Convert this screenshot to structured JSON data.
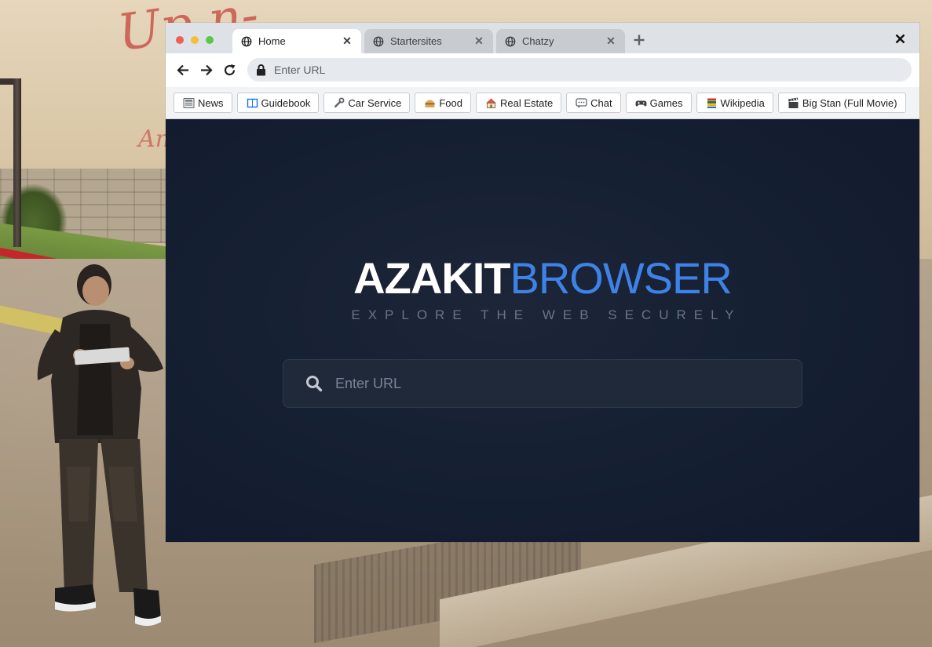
{
  "window": {
    "tabs": [
      {
        "label": "Home",
        "active": true
      },
      {
        "label": "Startersites",
        "active": false
      },
      {
        "label": "Chatzy",
        "active": false
      }
    ]
  },
  "toolbar": {
    "url_placeholder": "Enter URL"
  },
  "bookmarks": [
    {
      "label": "News",
      "icon": "newspaper-icon"
    },
    {
      "label": "Guidebook",
      "icon": "book-icon"
    },
    {
      "label": "Car Service",
      "icon": "wrench-icon"
    },
    {
      "label": "Food",
      "icon": "burger-icon"
    },
    {
      "label": "Real Estate",
      "icon": "house-icon"
    },
    {
      "label": "Chat",
      "icon": "speech-bubble-icon"
    },
    {
      "label": "Games",
      "icon": "gamepad-icon"
    },
    {
      "label": "Wikipedia",
      "icon": "books-icon"
    },
    {
      "label": "Big Stan (Full Movie)",
      "icon": "clapperboard-icon"
    }
  ],
  "home": {
    "brand_primary": "AZAKIT",
    "brand_secondary": "BROWSER",
    "tagline": "EXPLORE THE WEB SECURELY",
    "search_placeholder": "Enter URL"
  },
  "colors": {
    "accent": "#3e82e8",
    "content_bg": "#162033",
    "traffic_red": "#ee5f57",
    "traffic_yellow": "#f5be3b",
    "traffic_green": "#59c74a"
  }
}
